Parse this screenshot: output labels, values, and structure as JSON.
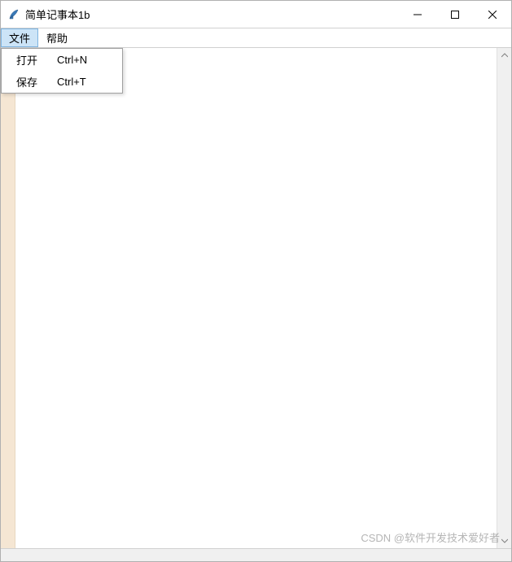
{
  "window": {
    "title": "简单记事本1b"
  },
  "menubar": {
    "items": [
      {
        "label": "文件",
        "active": true
      },
      {
        "label": "帮助",
        "active": false
      }
    ]
  },
  "dropdown": {
    "items": [
      {
        "label": "打开",
        "accel": "Ctrl+N"
      },
      {
        "label": "保存",
        "accel": "Ctrl+T"
      }
    ]
  },
  "watermark": "CSDN @软件开发技术爱好者"
}
